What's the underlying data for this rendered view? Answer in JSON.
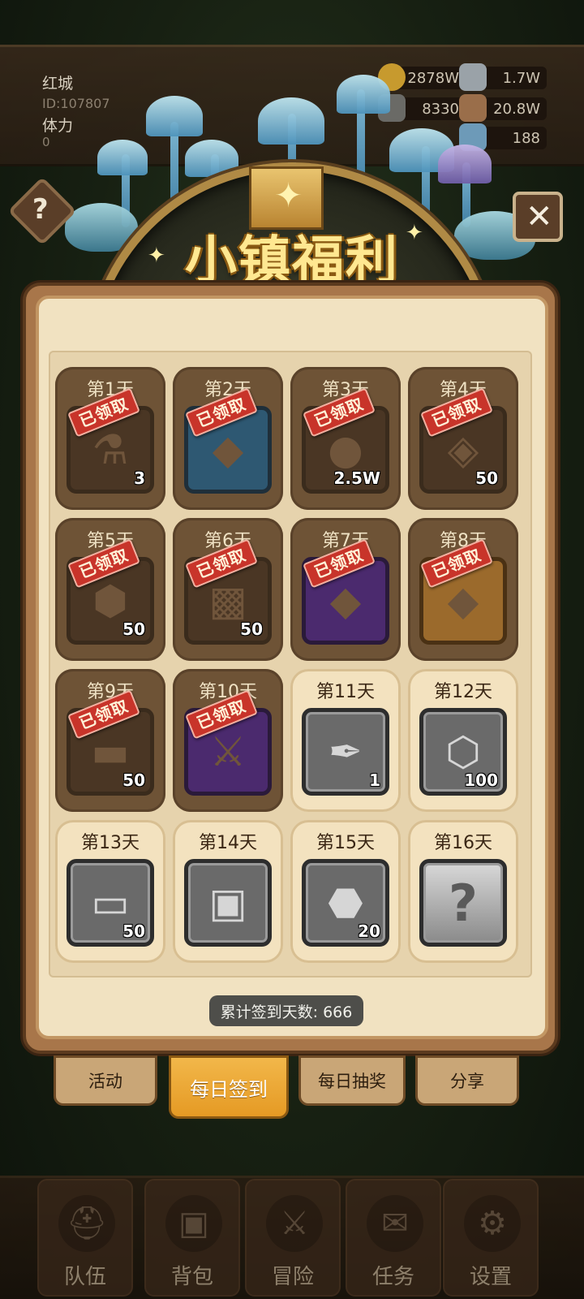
{
  "hud": {
    "player_name": "红城",
    "player_id": "ID:107807",
    "stamina_label": "体力",
    "stamina_value": "0",
    "resources": [
      {
        "icon": "gold-coin-icon",
        "value": "2878W"
      },
      {
        "icon": "iron-ingot-icon",
        "value": "1.7W"
      },
      {
        "icon": "stone-ore-icon",
        "value": "8330"
      },
      {
        "icon": "leather-icon",
        "value": "20.8W"
      },
      {
        "icon": "crystal-icon",
        "value": "188"
      }
    ]
  },
  "title": "小镇福利",
  "help_symbol": "?",
  "close_symbol": "✕",
  "stamp_text": "已领取",
  "days": [
    {
      "label": "第1天",
      "icon": "potion-flask-icon",
      "glyph": "⚗",
      "count": "3",
      "claimed": true,
      "frame": "normal"
    },
    {
      "label": "第2天",
      "icon": "blue-chest-icon",
      "glyph": "◆",
      "count": "",
      "claimed": true,
      "frame": "blue"
    },
    {
      "label": "第3天",
      "icon": "gold-coins-icon",
      "glyph": "●",
      "count": "2.5W",
      "claimed": true,
      "frame": "normal"
    },
    {
      "label": "第4天",
      "icon": "blue-gem-icon",
      "glyph": "◈",
      "count": "50",
      "claimed": true,
      "frame": "normal"
    },
    {
      "label": "第5天",
      "icon": "stone-ore-icon",
      "glyph": "⬢",
      "count": "50",
      "claimed": true,
      "frame": "normal"
    },
    {
      "label": "第6天",
      "icon": "leather-hide-icon",
      "glyph": "▩",
      "count": "50",
      "claimed": true,
      "frame": "normal"
    },
    {
      "label": "第7天",
      "icon": "purple-chest-icon",
      "glyph": "◆",
      "count": "",
      "claimed": true,
      "frame": "purple"
    },
    {
      "label": "第8天",
      "icon": "orange-chest-icon",
      "glyph": "◆",
      "count": "",
      "claimed": true,
      "frame": "orange"
    },
    {
      "label": "第9天",
      "icon": "iron-bar-icon",
      "glyph": "▬",
      "count": "50",
      "claimed": true,
      "frame": "normal"
    },
    {
      "label": "第10天",
      "icon": "sword-icon",
      "glyph": "⚔",
      "count": "",
      "claimed": true,
      "frame": "purple"
    },
    {
      "label": "第11天",
      "icon": "feather-quill-icon",
      "glyph": "✒",
      "count": "1",
      "claimed": false,
      "frame": "normal"
    },
    {
      "label": "第12天",
      "icon": "silver-crystal-icon",
      "glyph": "⬡",
      "count": "100",
      "claimed": false,
      "frame": "normal"
    },
    {
      "label": "第13天",
      "icon": "wood-log-icon",
      "glyph": "▭",
      "count": "50",
      "claimed": false,
      "frame": "normal"
    },
    {
      "label": "第14天",
      "icon": "backpack-icon",
      "glyph": "▣",
      "count": "",
      "claimed": false,
      "frame": "normal"
    },
    {
      "label": "第15天",
      "icon": "rune-stone-icon",
      "glyph": "⬣",
      "count": "20",
      "claimed": false,
      "frame": "normal"
    },
    {
      "label": "第16天",
      "icon": "mystery-box-icon",
      "glyph": "?",
      "count": "",
      "claimed": false,
      "frame": "mystery"
    }
  ],
  "total_signin": "累计签到天数: 666",
  "tabs": [
    {
      "label": "活动",
      "active": false
    },
    {
      "label": "每日签到",
      "active": true
    },
    {
      "label": "每日抽奖",
      "active": false
    },
    {
      "label": "分享",
      "active": false
    }
  ],
  "bottom_nav": [
    {
      "label": "队伍",
      "icon": "helmet-icon",
      "glyph": "⛑"
    },
    {
      "label": "背包",
      "icon": "bag-icon",
      "glyph": "▣"
    },
    {
      "label": "冒险",
      "icon": "crossed-swords-icon",
      "glyph": "⚔"
    },
    {
      "label": "任务",
      "icon": "quest-scroll-icon",
      "glyph": "✉"
    },
    {
      "label": "设置",
      "icon": "gear-icon",
      "glyph": "⚙"
    }
  ],
  "colors": {
    "panel": "#f1e2c1",
    "claimed_cell": "#6e5336",
    "stamp": "#c8342a",
    "active_tab": "#e59a24",
    "title": "#ffe891"
  }
}
